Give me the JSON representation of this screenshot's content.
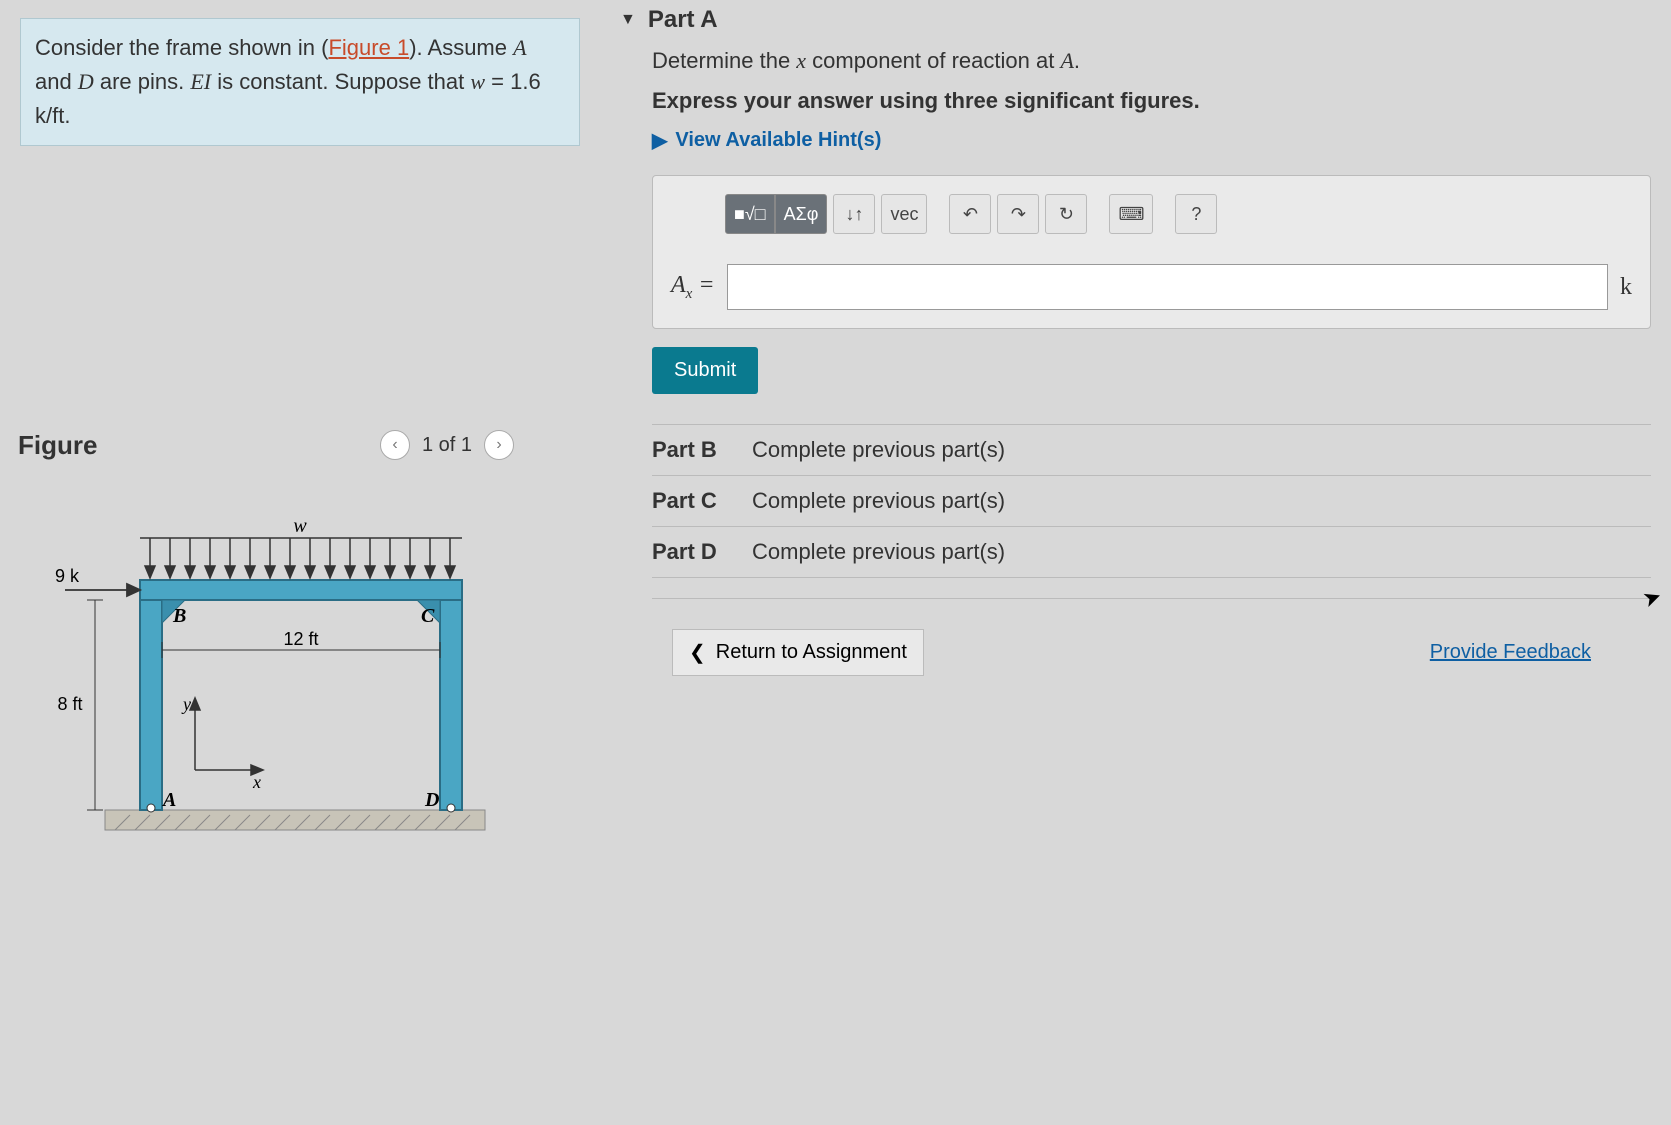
{
  "problem": {
    "prefix": "Consider the frame shown in (",
    "figlink": "Figure 1",
    "mid1": "). Assume ",
    "varA": "A",
    "mid2": " and ",
    "varD": "D",
    "mid3": " are pins. ",
    "varEI": "EI",
    "mid4": " is constant. Suppose that ",
    "varw": "w",
    "mid5": " = 1.6 k/ft."
  },
  "figure": {
    "title": "Figure",
    "counter": "1 of 1",
    "labels": {
      "w": "w",
      "load": "9 k",
      "height": "8 ft",
      "span": "12 ft",
      "B": "B",
      "C": "C",
      "A": "A",
      "D": "D",
      "x": "x",
      "y": "y"
    }
  },
  "partA": {
    "header": "Part A",
    "prompt_pre": "Determine the ",
    "prompt_var": "x",
    "prompt_mid": " component of reaction at ",
    "prompt_A": "A",
    "prompt_end": ".",
    "express": "Express your answer using three significant figures.",
    "hints": "View Available Hint(s)",
    "lhs_var": "A",
    "lhs_sub": "x",
    "lhs_eq": " =",
    "unit": "k",
    "submit": "Submit",
    "toolbar": {
      "templates": "■√□",
      "greek": "ΑΣφ",
      "scripts": "↓↑",
      "vec": "vec",
      "undo": "↶",
      "redo": "↷",
      "reset": "↻",
      "keyboard": "⌨",
      "help": "?"
    }
  },
  "parts_locked": {
    "B": {
      "label": "Part B",
      "msg": "Complete previous part(s)"
    },
    "C": {
      "label": "Part C",
      "msg": "Complete previous part(s)"
    },
    "D": {
      "label": "Part D",
      "msg": "Complete previous part(s)"
    }
  },
  "footer": {
    "return": "Return to Assignment",
    "feedback": "Provide Feedback"
  }
}
